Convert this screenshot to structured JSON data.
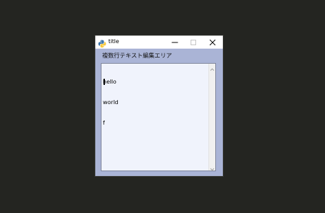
{
  "window": {
    "title": "title",
    "icon": "python-icon",
    "controls": {
      "minimize": "minimize-icon",
      "maximize": "maximize-icon",
      "close": "close-icon"
    }
  },
  "editor": {
    "label": "複数行テキスト編集エリア",
    "lines": [
      "hello",
      "world",
      "f"
    ]
  },
  "colors": {
    "desktop": "#242521",
    "window_body": "#aab4d6",
    "textarea_bg": "#f0f3fc"
  }
}
